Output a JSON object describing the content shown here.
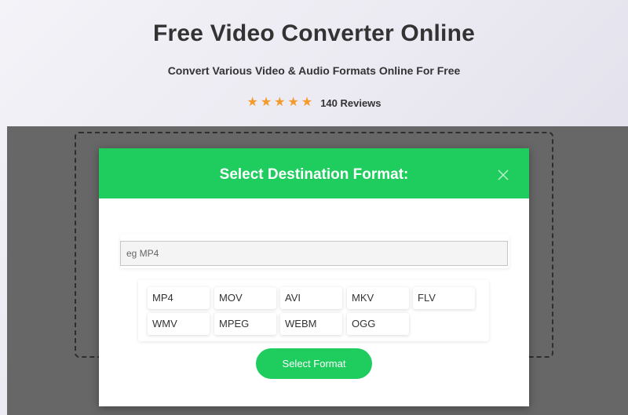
{
  "hero": {
    "title": "Free Video Converter Online",
    "subtitle": "Convert Various Video & Audio Formats Online For Free",
    "stars": [
      "★",
      "★",
      "★",
      "★",
      "★"
    ],
    "reviews": "140 Reviews"
  },
  "modal": {
    "title": "Select Destination Format:",
    "search_placeholder": "eg MP4",
    "formats": [
      "MP4",
      "MOV",
      "AVI",
      "MKV",
      "FLV",
      "WMV",
      "MPEG",
      "WEBM",
      "OGG"
    ],
    "select_label": "Select Format"
  },
  "colors": {
    "accent": "#1fcd5f",
    "star": "#f39a2b",
    "overlay": "#676767"
  }
}
